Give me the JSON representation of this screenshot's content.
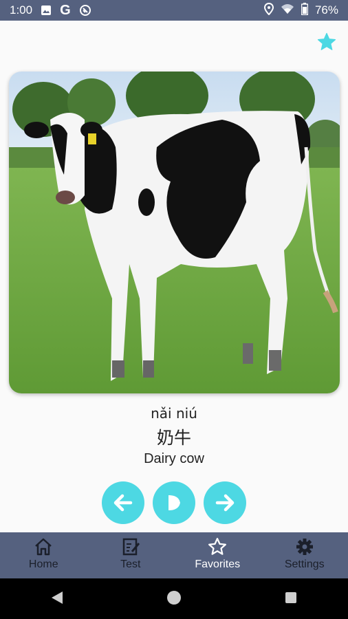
{
  "status_bar": {
    "time": "1:00",
    "battery": "76%",
    "icons": [
      "image-icon",
      "google-g-icon",
      "sync-icon",
      "location-icon",
      "wifi-icon",
      "battery-icon"
    ]
  },
  "favorite": {
    "icon": "star-icon",
    "color": "#4dd8e3"
  },
  "card": {
    "pinyin": "nǎi niú",
    "hanzi": "奶牛",
    "english": "Dairy cow"
  },
  "controls": {
    "prev_icon": "arrow-left-icon",
    "play_icon": "play-icon",
    "next_icon": "arrow-right-icon",
    "accent": "#4dd8e3"
  },
  "bottom_nav": {
    "items": [
      {
        "label": "Home",
        "icon": "home-icon"
      },
      {
        "label": "Test",
        "icon": "test-clipboard-icon"
      },
      {
        "label": "Favorites",
        "icon": "star-outline-icon",
        "active": true
      },
      {
        "label": "Settings",
        "icon": "gear-icon"
      }
    ],
    "background": "#55617f"
  }
}
